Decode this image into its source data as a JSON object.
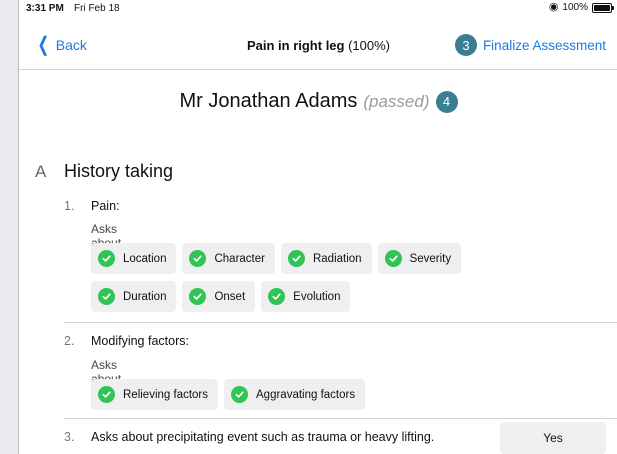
{
  "status_bar": {
    "time": "3:31 PM",
    "date": "Fri Feb 18",
    "battery": "100%"
  },
  "nav": {
    "back_label": "Back",
    "title_bold": "Pain in right leg",
    "title_suffix": " (100%)",
    "finalize_badge": "3",
    "finalize_label": "Finalize Assessment"
  },
  "patient": {
    "name": "Mr Jonathan Adams",
    "status": "(passed)",
    "badge": "4"
  },
  "section": {
    "letter": "A",
    "title": "History taking"
  },
  "items": [
    {
      "number": "1.",
      "title": "Pain:",
      "subtitle": "Asks about",
      "chips": [
        "Location",
        "Character",
        "Radiation",
        "Severity",
        "Duration",
        "Onset",
        "Evolution"
      ]
    },
    {
      "number": "2.",
      "title": "Modifying factors:",
      "subtitle": "Asks about",
      "chips": [
        "Relieving factors",
        "Aggravating factors"
      ]
    },
    {
      "number": "3.",
      "title": "Asks about precipitating event such as trauma or heavy lifting.",
      "answer": "Yes"
    }
  ],
  "colors": {
    "accent": "#1f7ae0",
    "badge": "#3b7e92",
    "check": "#30c454"
  }
}
